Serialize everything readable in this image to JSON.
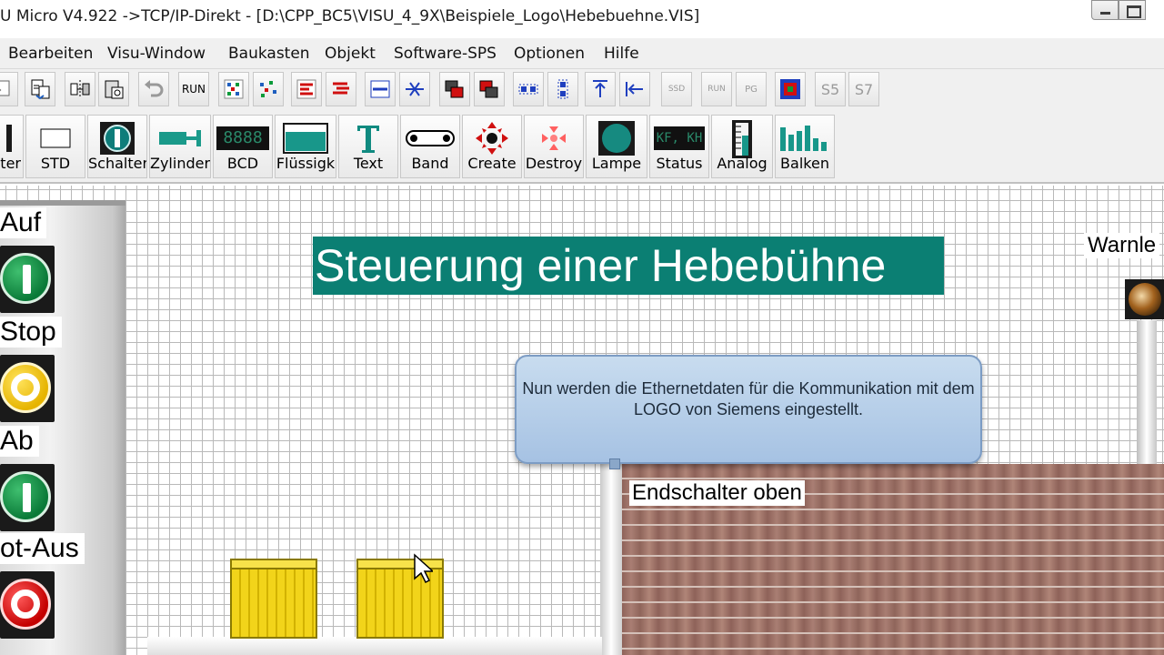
{
  "window": {
    "title": "U Micro V4.922 ->TCP/IP-Direkt - [D:\\CPP_BC5\\VISU_4_9X\\Beispiele_Logo\\Hebebuehne.VIS]"
  },
  "menu": {
    "items": [
      {
        "label": "Bearbeiten"
      },
      {
        "label": "Visu-Window"
      },
      {
        "label": "Baukasten"
      },
      {
        "label": "Objekt"
      },
      {
        "label": "Software-SPS"
      },
      {
        "label": "Optionen"
      },
      {
        "label": "Hilfe"
      }
    ]
  },
  "toolbar": {
    "run_label": "RUN",
    "s5_label": "S5",
    "s7_label": "S7",
    "ssd_label": "SSD",
    "pg_label": "PG",
    "run_dis_label": "RUN"
  },
  "tools": {
    "items": [
      {
        "label": "alter"
      },
      {
        "label": "STD"
      },
      {
        "label": "Schalter"
      },
      {
        "label": "Zylinder"
      },
      {
        "label": "BCD"
      },
      {
        "label": "Flüssigk"
      },
      {
        "label": "Text"
      },
      {
        "label": "Band"
      },
      {
        "label": "Create"
      },
      {
        "label": "Destroy"
      },
      {
        "label": "Lampe"
      },
      {
        "label": "Status"
      },
      {
        "label": "Analog"
      },
      {
        "label": "Balken"
      }
    ],
    "bcd_display": "8888",
    "status_display": "KF, KH"
  },
  "canvas": {
    "heading": "Steuerung einer Hebebühne",
    "callout_text": "Nun werden die Ethernetdaten für die Kommunikation mit dem LOGO von Siemens eingestellt.",
    "endschalter_label": "Endschalter oben",
    "warn_label": "Warnle",
    "panel": {
      "auf_label": "Auf",
      "stop_label": "Stop",
      "ab_label": "Ab",
      "notaus_label": "ot-Aus"
    }
  },
  "colors": {
    "heading_bg": "#0b7f73",
    "callout_bg": "#b7cfe9",
    "button_green": "#0a7a38",
    "button_yellow": "#e6b400",
    "button_red": "#c40000",
    "box_yellow": "#f2d41a",
    "brick": "#9e7268"
  }
}
